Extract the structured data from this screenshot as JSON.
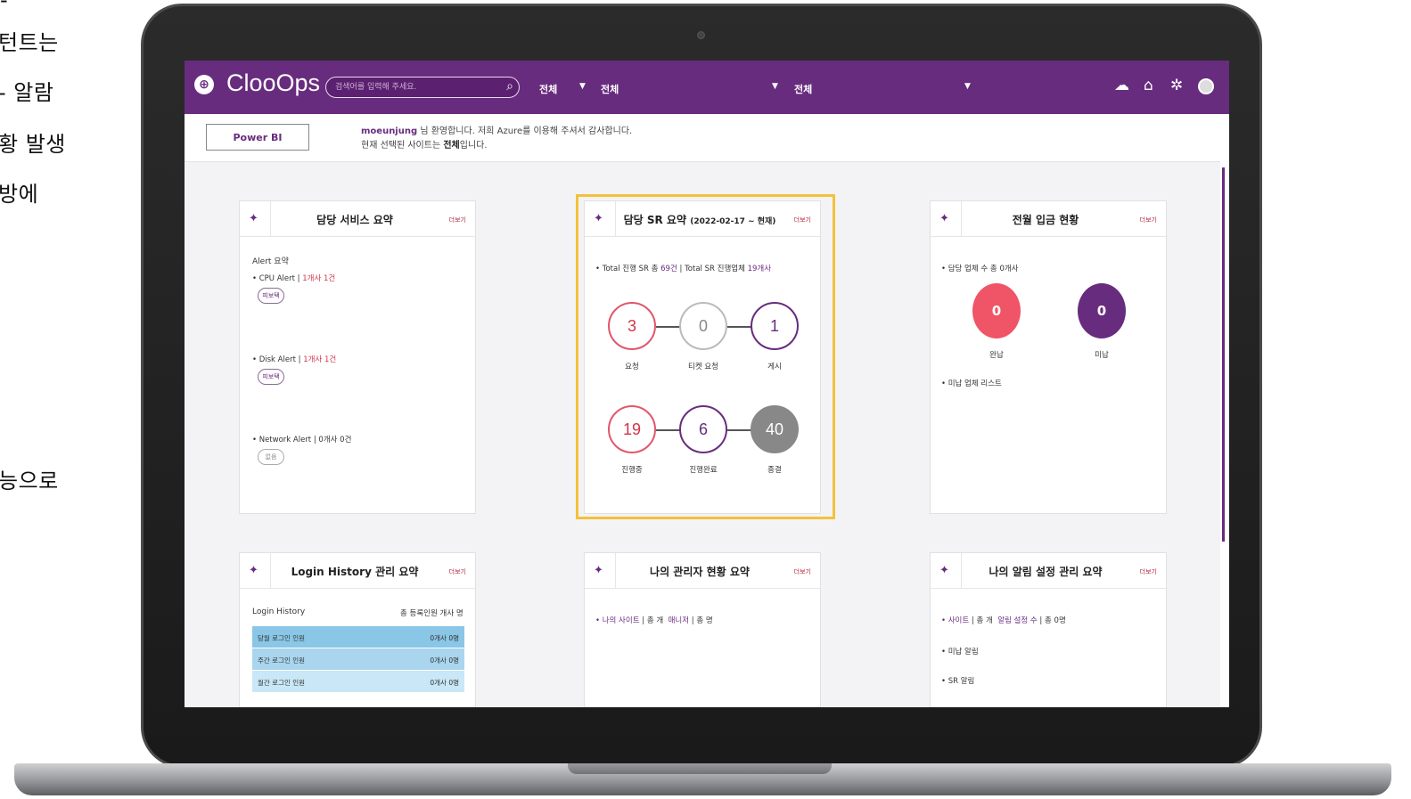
{
  "side_text": [
    "-",
    "턴트는",
    "- 알람",
    "황 발생",
    "방에",
    "능으로"
  ],
  "app": {
    "title": "ClooOps"
  },
  "search": {
    "placeholder": "검색어를 입력해 주세요."
  },
  "header": {
    "dropdowns": [
      "전체",
      "전체",
      "전체"
    ]
  },
  "subbar": {
    "powerbi_label": "Power BI",
    "user": "moeunjung",
    "welcome_rest": " 님 환영합니다. 저희 Azure를 이용해 주셔서 감사합니다.",
    "site_prefix": "현재 선택된 사이트는 ",
    "site_name": "전체",
    "site_suffix": "입니다."
  },
  "more_label": "더보기",
  "service_card": {
    "title": "담당 서비스 요약",
    "heading": "Alert 요약",
    "cpu_label": "• CPU Alert",
    "cpu_value": "1개사 1건",
    "disk_label": "• Disk Alert",
    "disk_value": "1개사 1건",
    "net_label": "• Network Alert",
    "net_value": "0개사 0건",
    "pill_active": "피보택",
    "pill_none": "없음"
  },
  "sr_card": {
    "title": "담당 SR 요약",
    "period": "(2022-02-17 ~ 현재)",
    "summary_a": "• Total 진행 SR 총 ",
    "summary_b": "69건",
    "summary_c": "Total SR 진행업체 ",
    "summary_d": "19개사",
    "steps": [
      {
        "value": "3",
        "label": "요청"
      },
      {
        "value": "0",
        "label": "티켓 요청"
      },
      {
        "value": "1",
        "label": "게시"
      },
      {
        "value": "19",
        "label": "진행중"
      },
      {
        "value": "6",
        "label": "진행완료"
      },
      {
        "value": "40",
        "label": "종결"
      }
    ]
  },
  "payment_card": {
    "title": "전월 입금 현황",
    "summary": "• 담당 업체 수 총 0개사",
    "paid_value": "0",
    "paid_label": "완납",
    "unpaid_value": "0",
    "unpaid_label": "미납",
    "list_label": "• 미납 업체 리스트"
  },
  "login_card": {
    "title": "Login History 관리 요약",
    "heading": "Login History",
    "total": "총 등록인원 개사 명",
    "rows": [
      {
        "label": "당월 로그인 인원",
        "value": "0개사 0명",
        "color": "#8ac6e6"
      },
      {
        "label": "주간 로그인 인원",
        "value": "0개사 0명",
        "color": "#a9d6ee"
      },
      {
        "label": "월간 로그인 인원",
        "value": "0개사 0명",
        "color": "#c9e7f6"
      }
    ]
  },
  "admin_card": {
    "title": "나의 관리자 현황 요약",
    "line_a": "• 나의 사이트",
    "line_b": "총 개",
    "line_c": "매니저",
    "line_d": "총 명"
  },
  "alarm_card": {
    "title": "나의 알림 설정 관리 요약",
    "line_a": "• 사이트",
    "line_b": "총 개",
    "line_c": "알림 설정 수",
    "line_d": "총 0명",
    "unpaid": "• 미납 알림",
    "sr": "• SR 알림"
  },
  "colors": {
    "brand": "#682c7e",
    "paid": "#ef5566",
    "highlight": "#f2c23a"
  }
}
